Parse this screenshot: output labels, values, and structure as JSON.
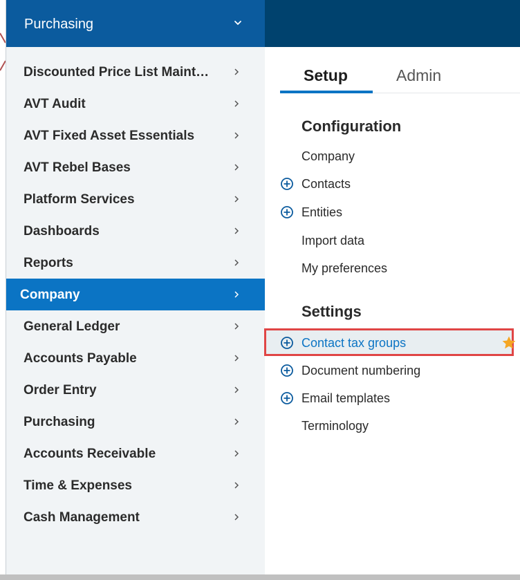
{
  "module_header": {
    "title": "Purchasing"
  },
  "menu": [
    {
      "label": "Discounted Price List Maint…"
    },
    {
      "label": "AVT Audit"
    },
    {
      "label": "AVT Fixed Asset Essentials"
    },
    {
      "label": "AVT Rebel Bases"
    },
    {
      "label": "Platform Services"
    },
    {
      "label": "Dashboards"
    },
    {
      "label": "Reports"
    },
    {
      "label": "Company",
      "active": true
    },
    {
      "label": "General Ledger"
    },
    {
      "label": "Accounts Payable"
    },
    {
      "label": "Order Entry"
    },
    {
      "label": "Purchasing"
    },
    {
      "label": "Accounts Receivable"
    },
    {
      "label": "Time & Expenses"
    },
    {
      "label": "Cash Management"
    }
  ],
  "tabs": {
    "setup": "Setup",
    "admin": "Admin"
  },
  "configuration": {
    "title": "Configuration",
    "items": [
      {
        "label": "Company",
        "plus": false
      },
      {
        "label": "Contacts",
        "plus": true
      },
      {
        "label": "Entities",
        "plus": true
      },
      {
        "label": "Import data",
        "plus": false
      },
      {
        "label": "My preferences",
        "plus": false
      }
    ]
  },
  "settings": {
    "title": "Settings",
    "items": [
      {
        "label": "Contact tax groups",
        "plus": true,
        "highlighted": true,
        "starred": true
      },
      {
        "label": "Document numbering",
        "plus": true
      },
      {
        "label": "Email templates",
        "plus": true
      },
      {
        "label": "Terminology",
        "plus": false
      }
    ]
  },
  "colors": {
    "header_blue": "#0b5b9e",
    "active_blue": "#0b74c4",
    "top_bar": "#00426e",
    "highlight_border": "#e04545",
    "star": "#f5a623"
  }
}
